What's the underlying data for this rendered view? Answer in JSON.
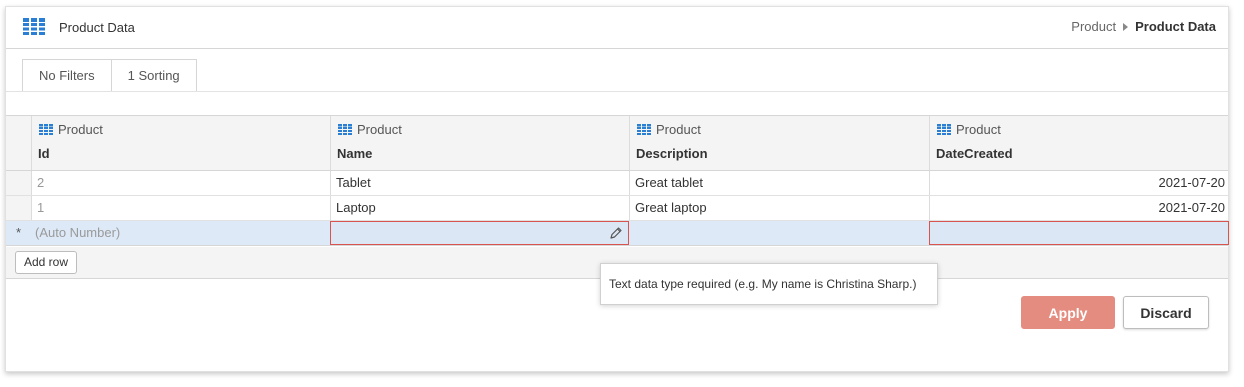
{
  "header": {
    "icon": "table-grid-icon",
    "title": "Product Data",
    "breadcrumb": {
      "parent": "Product",
      "current": "Product Data"
    }
  },
  "tabs": [
    {
      "label": "No Filters"
    },
    {
      "label": "1 Sorting"
    }
  ],
  "grid": {
    "columns": [
      {
        "table": "Product",
        "field": "Id"
      },
      {
        "table": "Product",
        "field": "Name"
      },
      {
        "table": "Product",
        "field": "Description"
      },
      {
        "table": "Product",
        "field": "DateCreated"
      }
    ],
    "rows": [
      {
        "Id": "2",
        "Name": "Tablet",
        "Description": "Great tablet",
        "DateCreated": "2021-07-20"
      },
      {
        "Id": "1",
        "Name": "Laptop",
        "Description": "Great laptop",
        "DateCreated": "2021-07-20"
      }
    ],
    "new_row": {
      "indicator": "*",
      "id_placeholder": "(Auto Number)"
    },
    "add_row_label": "Add row"
  },
  "tooltip": {
    "text": "Text data type required (e.g. My name is Christina Sharp.)"
  },
  "actions": {
    "apply_label": "Apply",
    "discard_label": "Discard"
  },
  "colors": {
    "accent_blue": "#2a7fd4",
    "apply": "#e58c80",
    "error": "#d9534f",
    "new_row_bg": "#dde9f7"
  }
}
